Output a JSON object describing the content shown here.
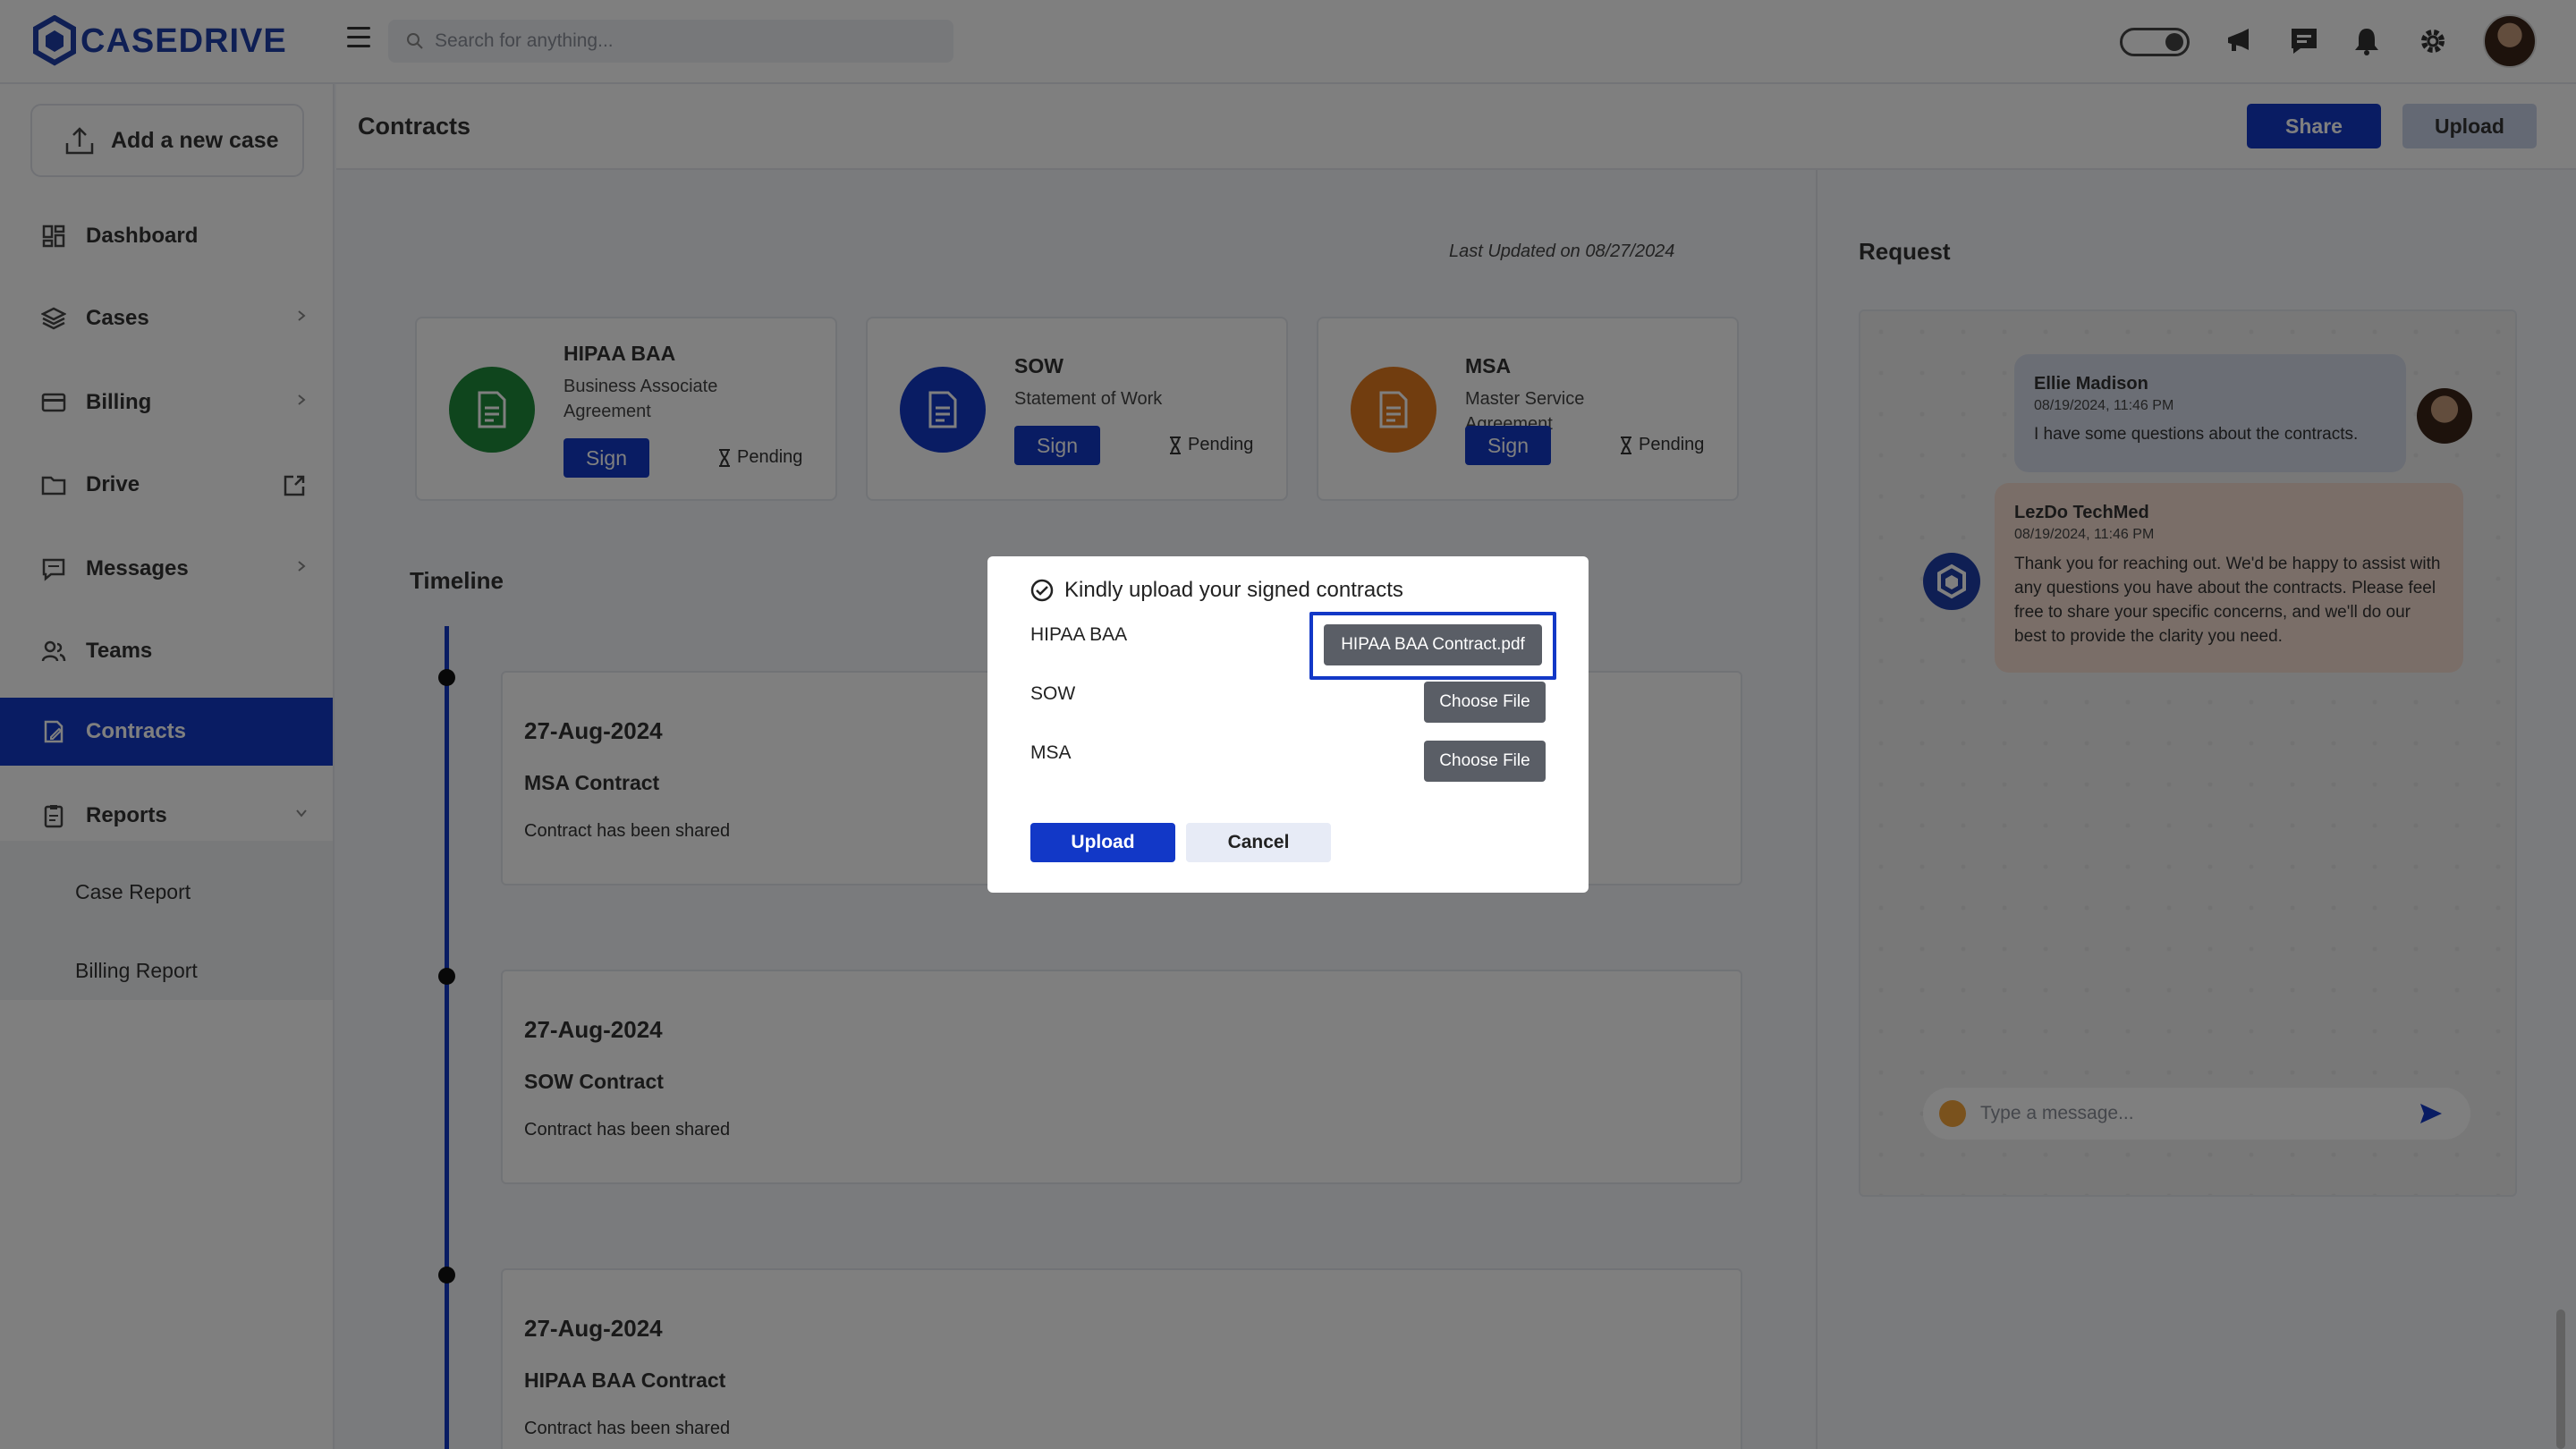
{
  "app": {
    "brand": "CASEDRIVE",
    "accent_color": "#1238c7"
  },
  "header": {
    "search_placeholder": "Search for anything...",
    "icons": [
      "menu-icon",
      "search-icon",
      "theme-toggle",
      "megaphone-icon",
      "chat-icon",
      "bell-icon",
      "gear-icon",
      "avatar"
    ]
  },
  "sidebar": {
    "add_case_label": "Add a new case",
    "items": [
      {
        "label": "Dashboard",
        "icon": "dashboard-icon"
      },
      {
        "label": "Cases",
        "icon": "layers-icon"
      },
      {
        "label": "Billing",
        "icon": "card-icon"
      },
      {
        "label": "Drive",
        "icon": "folder-icon"
      },
      {
        "label": "Messages",
        "icon": "message-icon"
      },
      {
        "label": "Teams",
        "icon": "users-icon"
      },
      {
        "label": "Contracts",
        "icon": "contract-icon",
        "active": true
      },
      {
        "label": "Reports",
        "icon": "report-icon"
      }
    ],
    "sub_items": [
      "Case Report",
      "Billing Report"
    ]
  },
  "page": {
    "title": "Contracts",
    "share_label": "Share",
    "upload_label": "Upload",
    "last_updated": "Last Updated on 08/27/2024"
  },
  "contracts": [
    {
      "title": "HIPAA BAA",
      "subtitle": "Business Associate Agreement",
      "sign_label": "Sign",
      "status": "Pending",
      "color": "#1f8a3a"
    },
    {
      "title": "SOW",
      "subtitle": "Statement of Work",
      "sign_label": "Sign",
      "status": "Pending",
      "color": "#1238c7"
    },
    {
      "title": "MSA",
      "subtitle": "Master Service Agreement",
      "sign_label": "Sign",
      "status": "Pending",
      "color": "#e27a1e"
    }
  ],
  "timeline": {
    "title": "Timeline",
    "entries": [
      {
        "date": "27-Aug-2024",
        "name": "MSA Contract",
        "desc": "Contract has been shared"
      },
      {
        "date": "27-Aug-2024",
        "name": "SOW Contract",
        "desc": "Contract has been shared"
      },
      {
        "date": "27-Aug-2024",
        "name": "HIPAA BAA Contract",
        "desc": "Contract has been shared"
      }
    ]
  },
  "request": {
    "title": "Request",
    "messages": [
      {
        "author": "Ellie Madison",
        "time": "08/19/2024, 11:46 PM",
        "text": "I have some questions about the contracts."
      },
      {
        "author": "LezDo TechMed",
        "time": "08/19/2024, 11:46 PM",
        "text": "Thank you for reaching out. We'd be happy to assist with any questions you have about the contracts. Please feel free to share your specific concerns, and we'll do our best to provide the clarity you need."
      }
    ],
    "input_placeholder": "Type a message..."
  },
  "modal": {
    "title": "Kindly upload your signed contracts",
    "rows": [
      {
        "label": "HIPAA BAA",
        "file_label": "HIPAA BAA Contract.pdf"
      },
      {
        "label": "SOW",
        "file_label": "Choose File"
      },
      {
        "label": "MSA",
        "file_label": "Choose File"
      }
    ],
    "upload_label": "Upload",
    "cancel_label": "Cancel"
  }
}
